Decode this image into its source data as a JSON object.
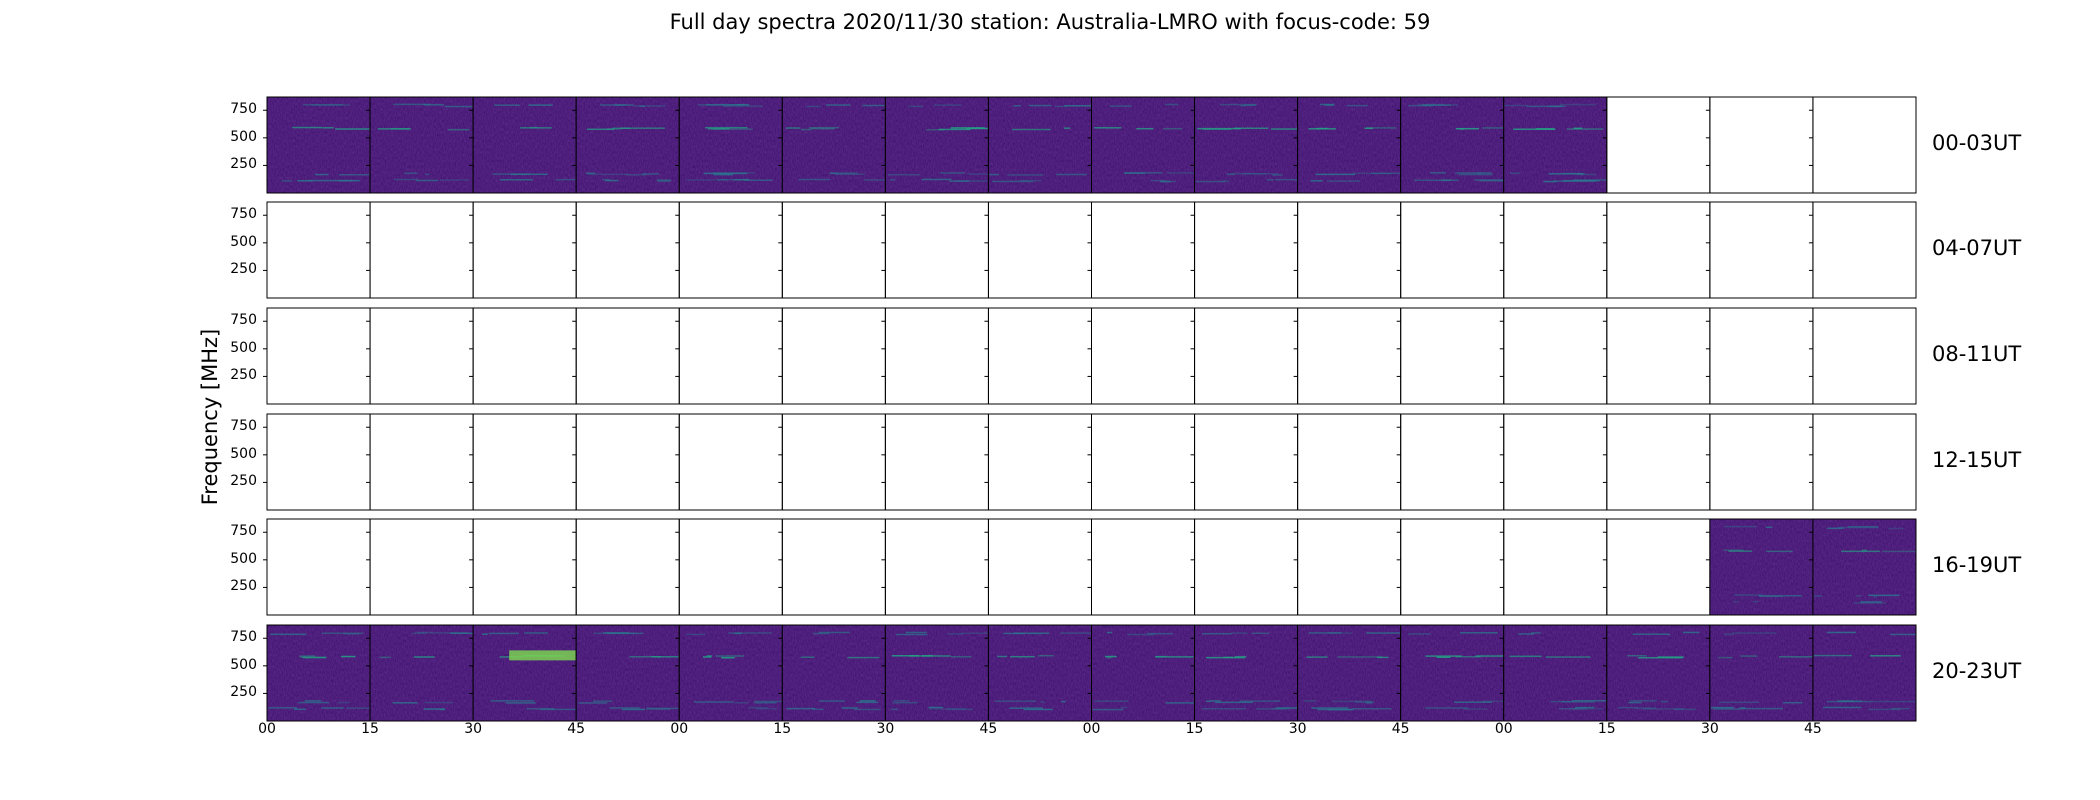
{
  "chart_data": {
    "type": "heatmap",
    "title": "Full day spectra 2020/11/30 station: Australia-LMRO with focus-code: 59",
    "ylabel": "Frequency [MHz]",
    "xlabel": "",
    "y_ticks": [
      "750",
      "500",
      "250"
    ],
    "x_ticks": [
      "00",
      "15",
      "30",
      "45",
      "00",
      "15",
      "30",
      "45",
      "00",
      "15",
      "30",
      "45",
      "00",
      "15",
      "30",
      "45"
    ],
    "rows": [
      {
        "label": "00-03UT",
        "panels_with_data": [
          0,
          1,
          2,
          3,
          4,
          5,
          6,
          7,
          8,
          9,
          10,
          11,
          12
        ]
      },
      {
        "label": "04-07UT",
        "panels_with_data": []
      },
      {
        "label": "08-11UT",
        "panels_with_data": []
      },
      {
        "label": "12-15UT",
        "panels_with_data": []
      },
      {
        "label": "16-19UT",
        "panels_with_data": [
          14,
          15
        ]
      },
      {
        "label": "20-23UT",
        "panels_with_data": [
          0,
          1,
          2,
          3,
          4,
          5,
          6,
          7,
          8,
          9,
          10,
          11,
          12,
          13,
          14,
          15
        ]
      }
    ],
    "panels_per_row": 16,
    "ylim": [
      0,
      870
    ],
    "colormap": [
      "#3b0f6b",
      "#45226e",
      "#2a788e",
      "#22a884",
      "#7ad151"
    ]
  }
}
